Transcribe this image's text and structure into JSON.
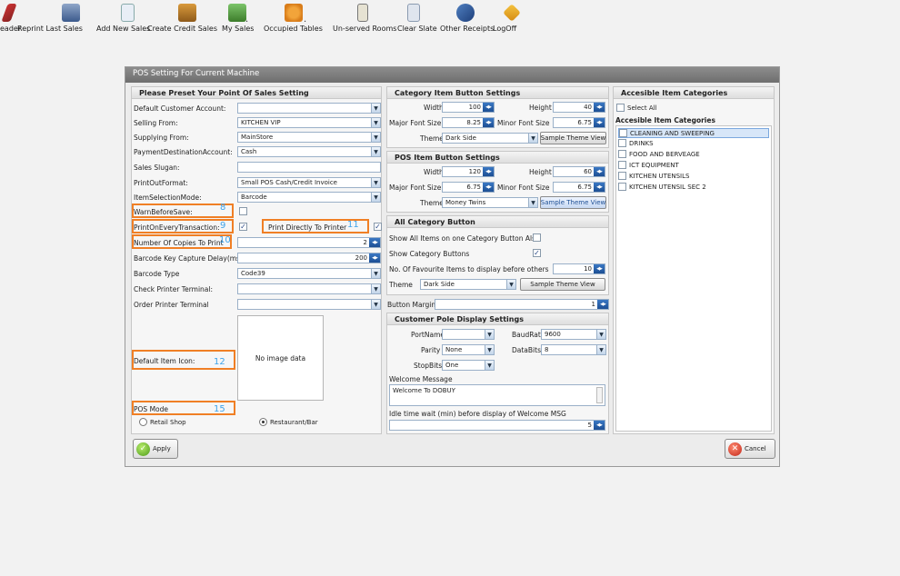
{
  "toolbar": {
    "items": [
      {
        "label": "eader",
        "icon": "edit-icon"
      },
      {
        "label": "Reprint Last Sales",
        "icon": "printer-icon"
      },
      {
        "label": "Add New Sales",
        "icon": "document-icon"
      },
      {
        "label": "Create Credit Sales",
        "icon": "briefcase-icon"
      },
      {
        "label": "My Sales",
        "icon": "monitor-icon"
      },
      {
        "label": "Occupied Tables",
        "icon": "people-icon"
      },
      {
        "label": "Un-served Rooms",
        "icon": "clipboard-icon"
      },
      {
        "label": "Clear Slate",
        "icon": "clear-document-icon"
      },
      {
        "label": "Other Receipts",
        "icon": "receipt-icon"
      },
      {
        "label": "LogOff",
        "icon": "logoff-icon"
      }
    ]
  },
  "dialog": {
    "title": "POS Setting For Current Machine",
    "left_panel": {
      "heading": "Please Preset Your Point Of Sales Setting",
      "default_customer_account_label": "Default Customer Account:",
      "default_customer_account_value": "",
      "selling_from_label": "Selling From:",
      "selling_from_value": "KITCHEN VIP",
      "supplying_from_label": "Supplying From:",
      "supplying_from_value": "MainStore",
      "payment_destination_label": "PaymentDestinationAccount:",
      "payment_destination_value": "Cash",
      "sales_slugan_label": "Sales Slugan:",
      "sales_slugan_value": "",
      "printout_format_label": "PrintOutFormat:",
      "printout_format_value": "Small POS Cash/Credit Invoice",
      "item_selection_mode_label": "ItemSelectionMode:",
      "item_selection_mode_value": "Barcode",
      "warn_before_save_label": "WarnBeforeSave:",
      "warn_before_save_checked": false,
      "print_on_every_transaction_label": "PrintOnEveryTransaction:",
      "print_on_every_transaction_checked": true,
      "print_directly_label": "Print Directly To Printer",
      "print_directly_checked": true,
      "copies_label": "Number Of Copies To Print",
      "copies_value": "2",
      "barcode_delay_label": "Barcode Key Capture Delay(ms)",
      "barcode_delay_value": "200",
      "barcode_type_label": "Barcode Type",
      "barcode_type_value": "Code39",
      "check_printer_label": "Check Printer Terminal:",
      "check_printer_value": "",
      "order_printer_label": "Order Printer Terminal",
      "order_printer_value": "",
      "default_item_icon_label": "Default Item Icon:",
      "no_image_text": "No image data",
      "pos_mode_label": "POS Mode",
      "retail_shop_label": "Retail Shop",
      "restaurant_bar_label": "Restaurant/Bar",
      "selected_mode": "Restaurant/Bar",
      "annotations": [
        "8",
        "9",
        "10",
        "11",
        "12",
        "15"
      ]
    },
    "category_item_button": {
      "heading": "Category Item Button Settings",
      "width_label": "Width",
      "width_value": "100",
      "height_label": "Height",
      "height_value": "40",
      "major_font_label": "Major Font Size",
      "major_font_value": "8.25",
      "minor_font_label": "Minor Font Size",
      "minor_font_value": "6.75",
      "theme_label": "Theme",
      "theme_value": "Dark Side",
      "sample_label": "Sample Theme View"
    },
    "pos_item_button": {
      "heading": "POS Item Button Settings",
      "width_label": "Width",
      "width_value": "120",
      "height_label": "Height",
      "height_value": "60",
      "major_font_label": "Major Font Size",
      "major_font_value": "6.75",
      "minor_font_label": "Minor Font Size",
      "minor_font_value": "6.75",
      "theme_label": "Theme",
      "theme_value": "Money Twins",
      "sample_label": "Sample Theme View"
    },
    "all_category_button": {
      "heading": "All Category Button",
      "show_all_items_label": "Show All Items on one Category Button Also",
      "show_all_items_checked": false,
      "show_category_buttons_label": "Show Category Buttons",
      "show_category_buttons_checked": true,
      "favourites_label": "No. Of Favourite Items to display before others",
      "favourites_value": "10",
      "theme_label": "Theme",
      "theme_value": "Dark Side",
      "sample_label": "Sample Theme View",
      "button_margin_label": "Button Margin",
      "button_margin_value": "1"
    },
    "pole_display": {
      "heading": "Customer Pole Display Settings",
      "portname_label": "PortName",
      "portname_value": "",
      "baudrate_label": "BaudRate",
      "baudrate_value": "9600",
      "parity_label": "Parity",
      "parity_value": "None",
      "databits_label": "DataBits",
      "databits_value": "8",
      "stopbits_label": "StopBits",
      "stopbits_value": "One",
      "welcome_label": "Welcome Message",
      "welcome_value": "Welcome To DOBUY",
      "idle_label": "Idle time wait (min) before display of Welcome MSG",
      "idle_value": "5"
    },
    "categories": {
      "heading": "Accesible Item Categories",
      "select_all_label": "Select All",
      "list_heading": "Accesible Item Categories",
      "items": [
        "CLEANING AND SWEEPING",
        "DRINKS",
        "FOOD AND BERVEAGE",
        "ICT EQUIPMENT",
        "KITCHEN  UTENSILS",
        "KITCHEN UTENSIL SEC 2"
      ]
    },
    "apply_label": "Apply",
    "cancel_label": "Cancel"
  }
}
